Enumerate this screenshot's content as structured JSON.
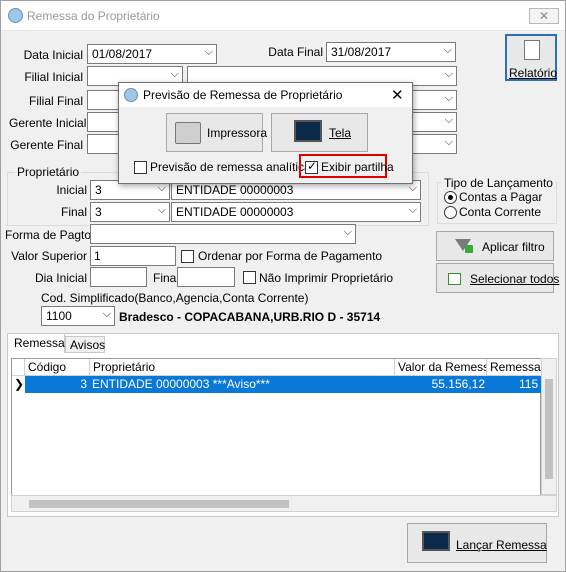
{
  "window": {
    "title": "Remessa do Proprietário",
    "close": "✕"
  },
  "filters": {
    "data_inicial_label": "Data Inicial",
    "data_inicial": "01/08/2017",
    "data_final_label": "Data Final",
    "data_final": "31/08/2017",
    "filial_inicial_label": "Filial Inicial",
    "filial_final_label": "Filial Final",
    "gerente_inicial_label": "Gerente Inicial",
    "gerente_final_label": "Gerente Final"
  },
  "relatorio_button": "Relatório",
  "proprietario": {
    "group_label": "Proprietário",
    "inicial_label": "Inicial",
    "inicial_code": "3",
    "inicial_name": "ENTIDADE 00000003",
    "final_label": "Final",
    "final_code": "3",
    "final_name": "ENTIDADE 00000003"
  },
  "tipo_lancamento": {
    "label": "Tipo de Lançamento",
    "opt1": "Contas a Pagar",
    "opt2": "Conta Corrente"
  },
  "forma_pagto_label": "Forma de Pagto.",
  "valor_superior_label": "Valor Superior",
  "valor_superior": "1",
  "ordenar_label": "Ordenar por Forma de Pagamento",
  "dia_inicial_label": "Dia Inicial",
  "final_label": "Final",
  "nao_imprimir_label": "Não Imprimir Proprietário",
  "aplicar_filtro": "Aplicar filtro",
  "selecionar_todos": "Selecionar todos",
  "cod_simplificado_label": "Cod. Simplificado(Banco,Agencia,Conta Corrente)",
  "cod_simplificado": "1100",
  "bank_text": "Bradesco - COPACABANA,URB.RIO D - 35714",
  "tabs": [
    "Remessa",
    "Avisos"
  ],
  "grid": {
    "headers": [
      "Código",
      "Proprietário",
      "Valor da Remessa",
      "Remessa A"
    ],
    "row": {
      "codigo": "3",
      "proprietario": "ENTIDADE 00000003 ***Aviso***",
      "valor": "55.156,12",
      "remessa": "115"
    }
  },
  "lancar_remessa": "Lançar Remessa",
  "dialog": {
    "title": "Previsão de Remessa de Proprietário",
    "impressora": "Impressora",
    "tela": "Tela",
    "previsao_analitica": "Previsão de remessa analítica",
    "exibir_partilha": "Exibir partilha"
  },
  "colors": {
    "highlight": "#0a78d7",
    "alert_border": "#e00000"
  }
}
